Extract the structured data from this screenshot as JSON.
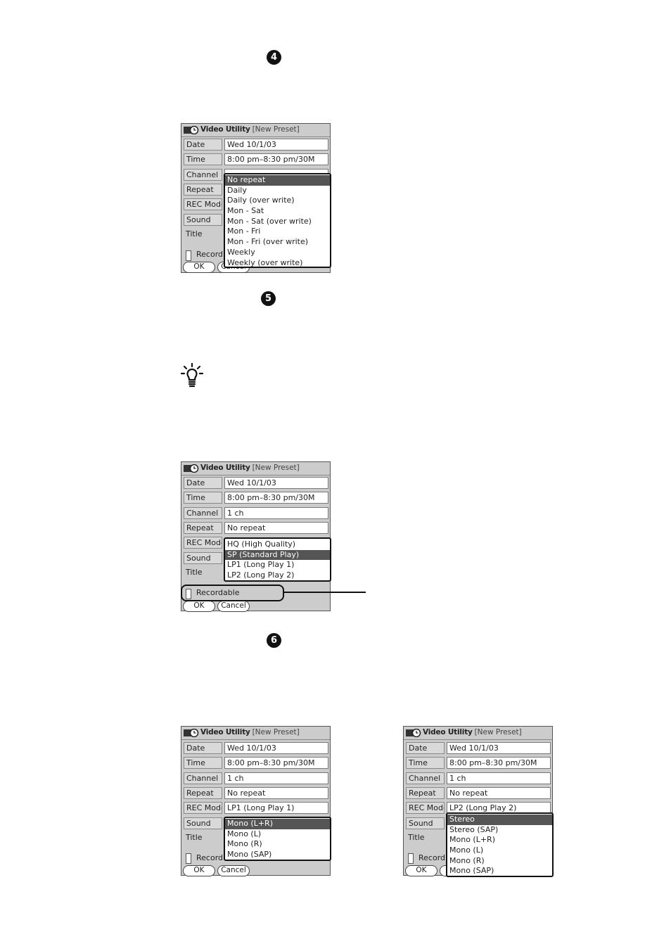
{
  "steps": [
    "4",
    "5",
    "6"
  ],
  "screens": [
    {
      "app_title": "Video Utility",
      "subtitle": "– [New Preset]",
      "rows": [
        {
          "label": "Date",
          "value": "Wed 10/1/03"
        },
        {
          "label": "Time",
          "value": "8:00 pm–8:30 pm/30M"
        },
        {
          "label": "Channel",
          "value": ""
        },
        {
          "label": "Repeat",
          "value": ""
        },
        {
          "label": "REC Mode",
          "value": ""
        },
        {
          "label": "Sound",
          "value": ""
        }
      ],
      "title_label": "Title",
      "checkbox_label": "Record",
      "ok": "OK",
      "cancel": "Cancel",
      "dropdown": {
        "options": [
          "No repeat",
          "Daily",
          "Daily (over write)",
          "Mon - Sat",
          "Mon - Sat (over write)",
          "Mon - Fri",
          "Mon - Fri (over write)",
          "Weekly",
          "Weekly (over write)"
        ],
        "selected": "No repeat"
      }
    },
    {
      "app_title": "Video Utility",
      "subtitle": "– [New Preset]",
      "rows": [
        {
          "label": "Date",
          "value": "Wed 10/1/03"
        },
        {
          "label": "Time",
          "value": "8:00 pm–8:30 pm/30M"
        },
        {
          "label": "Channel",
          "value": "1 ch"
        },
        {
          "label": "Repeat",
          "value": "No repeat"
        },
        {
          "label": "REC Mode",
          "value": ""
        },
        {
          "label": "Sound",
          "value": ""
        }
      ],
      "title_label": "Title",
      "checkbox_label": "Recordable",
      "ok": "OK",
      "cancel": "Cancel",
      "dropdown": {
        "options": [
          "HQ (High Quality)",
          "SP (Standard Play)",
          "LP1 (Long Play 1)",
          "LP2 (Long Play 2)"
        ],
        "selected": "SP (Standard Play)"
      }
    },
    {
      "app_title": "Video Utility",
      "subtitle": "– [New Preset]",
      "rows": [
        {
          "label": "Date",
          "value": "Wed 10/1/03"
        },
        {
          "label": "Time",
          "value": "8:00 pm–8:30 pm/30M"
        },
        {
          "label": "Channel",
          "value": "1 ch"
        },
        {
          "label": "Repeat",
          "value": "No repeat"
        },
        {
          "label": "REC Mode",
          "value": "LP1 (Long Play 1)"
        },
        {
          "label": "Sound",
          "value": ""
        }
      ],
      "title_label": "Title",
      "checkbox_label": "Record",
      "ok": "OK",
      "cancel": "Cancel",
      "dropdown": {
        "options": [
          "Mono (L+R)",
          "Mono (L)",
          "Mono (R)",
          "Mono (SAP)"
        ],
        "selected": "Mono (L+R)"
      }
    },
    {
      "app_title": "Video Utility",
      "subtitle": "– [New Preset]",
      "rows": [
        {
          "label": "Date",
          "value": "Wed 10/1/03"
        },
        {
          "label": "Time",
          "value": "8:00 pm–8:30 pm/30M"
        },
        {
          "label": "Channel",
          "value": "1 ch"
        },
        {
          "label": "Repeat",
          "value": "No repeat"
        },
        {
          "label": "REC Mode",
          "value": "LP2 (Long Play 2)"
        },
        {
          "label": "Sound",
          "value": ""
        }
      ],
      "title_label": "Title",
      "checkbox_label": "Record",
      "ok": "OK",
      "cancel": "",
      "dropdown": {
        "options": [
          "Stereo",
          "Stereo (SAP)",
          "Mono (L+R)",
          "Mono (L)",
          "Mono (R)",
          "Mono (SAP)"
        ],
        "selected": "Stereo"
      }
    }
  ],
  "icons": {
    "app": "video-utility-icon",
    "tip": "lightbulb-hint-icon"
  },
  "colors": {
    "selection": "#555555",
    "screen_bg": "#cccccc"
  }
}
